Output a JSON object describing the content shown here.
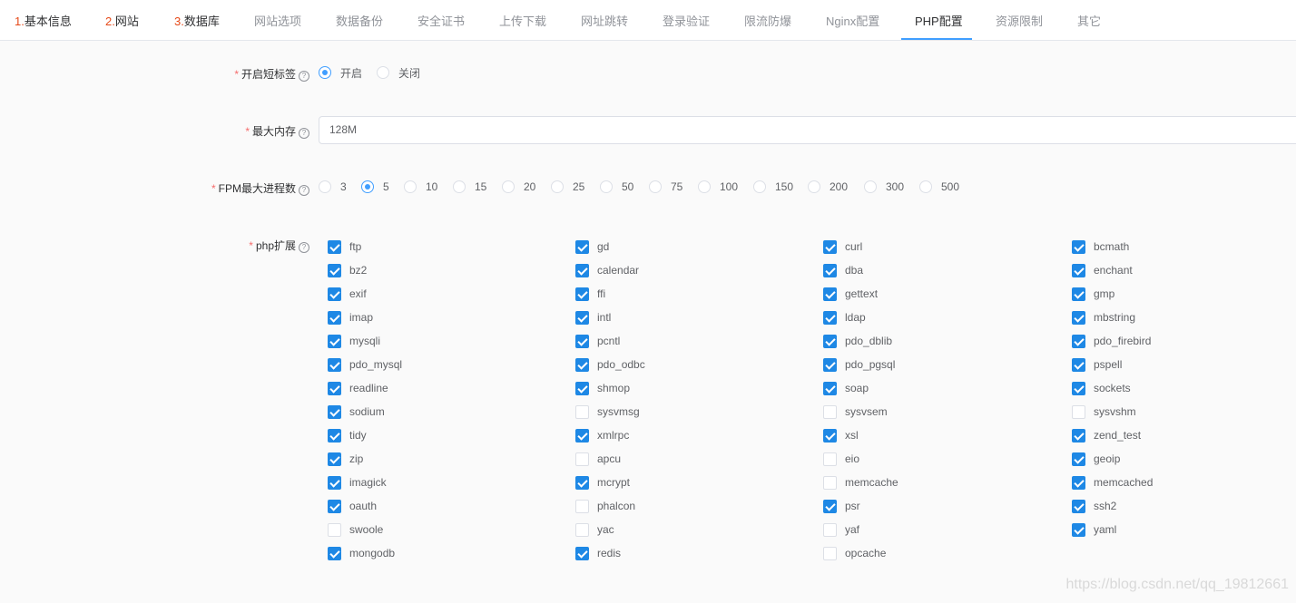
{
  "tabs": [
    {
      "num": "1.",
      "label": "基本信息",
      "state": "done"
    },
    {
      "num": "2.",
      "label": "网站",
      "state": "done"
    },
    {
      "num": "3.",
      "label": "数据库",
      "state": "done"
    },
    {
      "num": "",
      "label": "网站选项",
      "state": "normal"
    },
    {
      "num": "",
      "label": "数据备份",
      "state": "normal"
    },
    {
      "num": "",
      "label": "安全证书",
      "state": "normal"
    },
    {
      "num": "",
      "label": "上传下载",
      "state": "normal"
    },
    {
      "num": "",
      "label": "网址跳转",
      "state": "normal"
    },
    {
      "num": "",
      "label": "登录验证",
      "state": "normal"
    },
    {
      "num": "",
      "label": "限流防爆",
      "state": "normal"
    },
    {
      "num": "",
      "label": "Nginx配置",
      "state": "normal"
    },
    {
      "num": "",
      "label": "PHP配置",
      "state": "active"
    },
    {
      "num": "",
      "label": "资源限制",
      "state": "normal"
    },
    {
      "num": "",
      "label": "其它",
      "state": "normal"
    }
  ],
  "short_tag": {
    "label": "开启短标签",
    "options": [
      {
        "label": "开启",
        "checked": true
      },
      {
        "label": "关闭",
        "checked": false
      }
    ]
  },
  "max_memory": {
    "label": "最大内存",
    "value": "128M"
  },
  "fpm": {
    "label": "FPM最大进程数",
    "options": [
      {
        "label": "3",
        "checked": false
      },
      {
        "label": "5",
        "checked": true
      },
      {
        "label": "10",
        "checked": false
      },
      {
        "label": "15",
        "checked": false
      },
      {
        "label": "20",
        "checked": false
      },
      {
        "label": "25",
        "checked": false
      },
      {
        "label": "50",
        "checked": false
      },
      {
        "label": "75",
        "checked": false
      },
      {
        "label": "100",
        "checked": false
      },
      {
        "label": "150",
        "checked": false
      },
      {
        "label": "200",
        "checked": false
      },
      {
        "label": "300",
        "checked": false
      },
      {
        "label": "500",
        "checked": false
      }
    ]
  },
  "extensions": {
    "label": "php扩展",
    "items": [
      {
        "name": "ftp",
        "checked": true
      },
      {
        "name": "gd",
        "checked": true
      },
      {
        "name": "curl",
        "checked": true
      },
      {
        "name": "bcmath",
        "checked": true
      },
      {
        "name": "bz2",
        "checked": true
      },
      {
        "name": "calendar",
        "checked": true
      },
      {
        "name": "dba",
        "checked": true
      },
      {
        "name": "enchant",
        "checked": true
      },
      {
        "name": "exif",
        "checked": true
      },
      {
        "name": "ffi",
        "checked": true
      },
      {
        "name": "gettext",
        "checked": true
      },
      {
        "name": "gmp",
        "checked": true
      },
      {
        "name": "imap",
        "checked": true
      },
      {
        "name": "intl",
        "checked": true
      },
      {
        "name": "ldap",
        "checked": true
      },
      {
        "name": "mbstring",
        "checked": true
      },
      {
        "name": "mysqli",
        "checked": true
      },
      {
        "name": "pcntl",
        "checked": true
      },
      {
        "name": "pdo_dblib",
        "checked": true
      },
      {
        "name": "pdo_firebird",
        "checked": true
      },
      {
        "name": "pdo_mysql",
        "checked": true
      },
      {
        "name": "pdo_odbc",
        "checked": true
      },
      {
        "name": "pdo_pgsql",
        "checked": true
      },
      {
        "name": "pspell",
        "checked": true
      },
      {
        "name": "readline",
        "checked": true
      },
      {
        "name": "shmop",
        "checked": true
      },
      {
        "name": "soap",
        "checked": true
      },
      {
        "name": "sockets",
        "checked": true
      },
      {
        "name": "sodium",
        "checked": true
      },
      {
        "name": "sysvmsg",
        "checked": false
      },
      {
        "name": "sysvsem",
        "checked": false
      },
      {
        "name": "sysvshm",
        "checked": false
      },
      {
        "name": "tidy",
        "checked": true
      },
      {
        "name": "xmlrpc",
        "checked": true
      },
      {
        "name": "xsl",
        "checked": true
      },
      {
        "name": "zend_test",
        "checked": true
      },
      {
        "name": "zip",
        "checked": true
      },
      {
        "name": "apcu",
        "checked": false
      },
      {
        "name": "eio",
        "checked": false
      },
      {
        "name": "geoip",
        "checked": true
      },
      {
        "name": "imagick",
        "checked": true
      },
      {
        "name": "mcrypt",
        "checked": true
      },
      {
        "name": "memcache",
        "checked": false
      },
      {
        "name": "memcached",
        "checked": true
      },
      {
        "name": "oauth",
        "checked": true
      },
      {
        "name": "phalcon",
        "checked": false
      },
      {
        "name": "psr",
        "checked": true
      },
      {
        "name": "ssh2",
        "checked": true
      },
      {
        "name": "swoole",
        "checked": false
      },
      {
        "name": "yac",
        "checked": false
      },
      {
        "name": "yaf",
        "checked": false
      },
      {
        "name": "yaml",
        "checked": true
      },
      {
        "name": "mongodb",
        "checked": true
      },
      {
        "name": "redis",
        "checked": true
      },
      {
        "name": "opcache",
        "checked": false
      }
    ]
  },
  "watermark": "https://blog.csdn.net/qq_19812661",
  "colors": {
    "accent": "#409eff",
    "checkbox": "#1e88e5",
    "required": "#f56c6c",
    "step_number": "#e64a19"
  }
}
